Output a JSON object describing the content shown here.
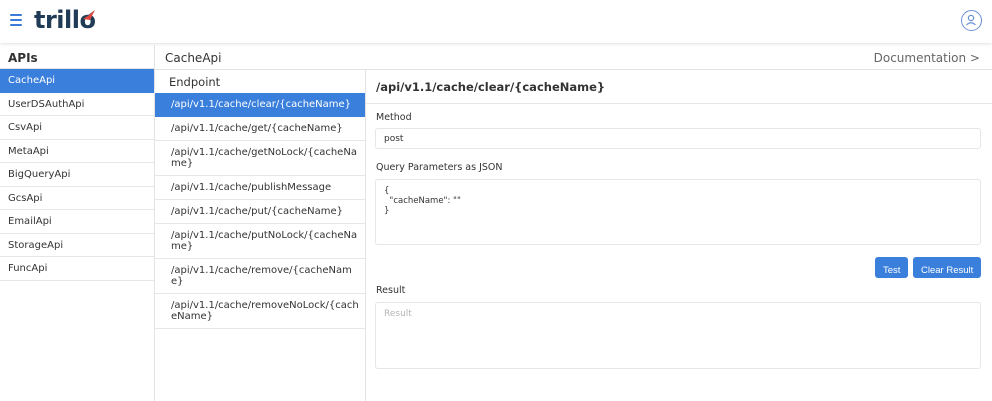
{
  "app": {
    "logo": "trillo"
  },
  "sidebar": {
    "heading": "APIs",
    "items": [
      {
        "label": "CacheApi",
        "active": true
      },
      {
        "label": "UserDSAuthApi"
      },
      {
        "label": "CsvApi"
      },
      {
        "label": "MetaApi"
      },
      {
        "label": "BigQueryApi"
      },
      {
        "label": "GcsApi"
      },
      {
        "label": "EmailApi"
      },
      {
        "label": "StorageApi"
      },
      {
        "label": "FuncApi"
      }
    ]
  },
  "header": {
    "title": "CacheApi",
    "doc_link": "Documentation >"
  },
  "endpoints": {
    "heading": "Endpoint",
    "items": [
      {
        "label": "/api/v1.1/cache/clear/{cacheName}",
        "active": true
      },
      {
        "label": "/api/v1.1/cache/get/{cacheName}"
      },
      {
        "label": "/api/v1.1/cache/getNoLock/{cacheName}"
      },
      {
        "label": "/api/v1.1/cache/publishMessage"
      },
      {
        "label": "/api/v1.1/cache/put/{cacheName}"
      },
      {
        "label": "/api/v1.1/cache/putNoLock/{cacheName}"
      },
      {
        "label": "/api/v1.1/cache/remove/{cacheName}"
      },
      {
        "label": "/api/v1.1/cache/removeNoLock/{cacheName}"
      }
    ]
  },
  "detail": {
    "title": "/api/v1.1/cache/clear/{cacheName}",
    "method_label": "Method",
    "method_value": "post",
    "query_label": "Query Parameters as JSON",
    "query_lines": [
      "{",
      "  \"cacheName\": \"\"",
      "}"
    ],
    "test_button": "Test",
    "clear_button": "Clear Result",
    "result_label": "Result",
    "result_placeholder": "Result"
  },
  "colors": {
    "accent": "#3a7fdc",
    "logo": "#1f3b55"
  }
}
